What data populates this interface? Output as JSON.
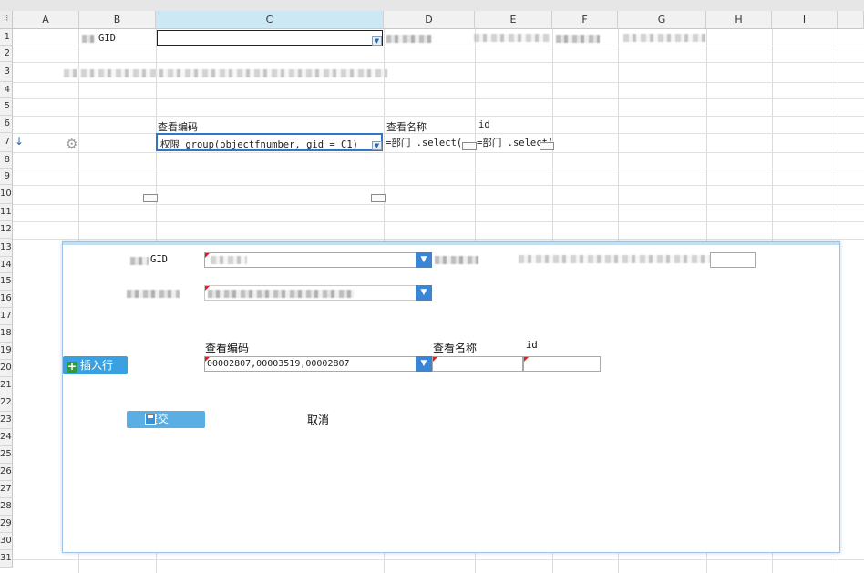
{
  "columns": [
    "A",
    "B",
    "C",
    "D",
    "E",
    "F",
    "G",
    "H",
    "I"
  ],
  "rows": [
    "1",
    "2",
    "3",
    "4",
    "5",
    "6",
    "7",
    "8",
    "9",
    "10",
    "11",
    "12",
    "13",
    "14",
    "15",
    "16",
    "17",
    "18",
    "19",
    "20",
    "21",
    "22",
    "23",
    "24",
    "25",
    "26",
    "27",
    "28",
    "29",
    "30",
    "31"
  ],
  "sheet": {
    "b1": "GID",
    "c6": "查看编码",
    "d6": "查看名称",
    "e6": "id",
    "c7": "权限 group(objectfnumber, gid = C1)",
    "d7": "=部门 .select(",
    "e7": "=部门 .select("
  },
  "form": {
    "gid_label": "GID",
    "col_code": "查看编码",
    "col_name": "查看名称",
    "col_id": "id",
    "code_value": "00002807,00003519,00002807",
    "name_value": "",
    "id_value": "",
    "insert_row": "插入行",
    "submit": "提交",
    "cancel": "取消"
  },
  "colors": {
    "accent": "#3a86d4",
    "selected_col_header": "#cce8f4",
    "active_cell_border": "#2f77c9",
    "required_marker": "#dd2222",
    "insert_plus": "#2e9b3e"
  },
  "icons": [
    "gear-icon",
    "dropdown-arrow-icon",
    "plus-icon",
    "save-disk-icon"
  ]
}
